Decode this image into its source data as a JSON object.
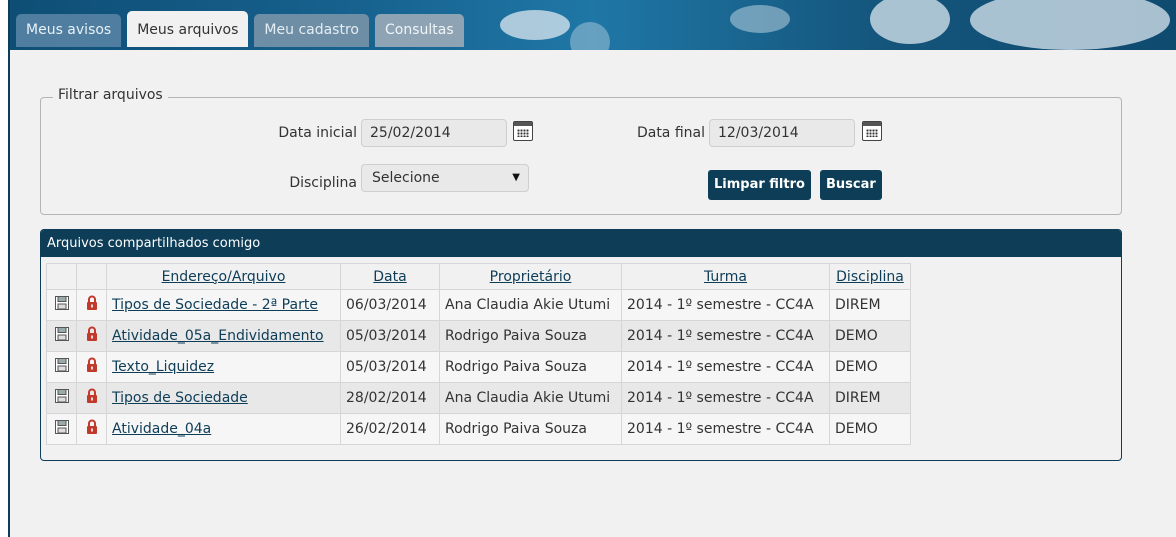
{
  "tabs": [
    {
      "label": "Meus avisos"
    },
    {
      "label": "Meus arquivos"
    },
    {
      "label": "Meu cadastro"
    },
    {
      "label": "Consultas"
    }
  ],
  "filter": {
    "legend": "Filtrar arquivos",
    "start_label": "Data inicial",
    "start_value": "25/02/2014",
    "end_label": "Data final",
    "end_value": "12/03/2014",
    "discipline_label": "Disciplina",
    "discipline_value": "Selecione",
    "clear_button": "Limpar filtro",
    "search_button": "Buscar"
  },
  "files": {
    "title": "Arquivos compartilhados comigo",
    "columns": [
      "Endereço/Arquivo",
      "Data",
      "Proprietário",
      "Turma",
      "Disciplina"
    ],
    "rows": [
      {
        "file": "Tipos de Sociedade - 2ª Parte",
        "date": "06/03/2014",
        "owner": "Ana Claudia Akie Utumi",
        "class": "2014 - 1º semestre - CC4A",
        "discipline": "DIREM"
      },
      {
        "file": "Atividade_05a_Endividamento",
        "date": "05/03/2014",
        "owner": "Rodrigo Paiva Souza",
        "class": "2014 - 1º semestre - CC4A",
        "discipline": "DEMO"
      },
      {
        "file": "Texto_Liquidez",
        "date": "05/03/2014",
        "owner": "Rodrigo Paiva Souza",
        "class": "2014 - 1º semestre - CC4A",
        "discipline": "DEMO"
      },
      {
        "file": "Tipos de Sociedade",
        "date": "28/02/2014",
        "owner": "Ana Claudia Akie Utumi",
        "class": "2014 - 1º semestre - CC4A",
        "discipline": "DIREM"
      },
      {
        "file": "Atividade_04a",
        "date": "26/02/2014",
        "owner": "Rodrigo Paiva Souza",
        "class": "2014 - 1º semestre - CC4A",
        "discipline": "DEMO"
      }
    ]
  },
  "icons": {
    "save": "floppy-disk-icon",
    "lock": "padlock-icon",
    "calendar": "calendar-icon"
  },
  "colors": {
    "header": "#0d3d57",
    "lock": "#c0392b"
  }
}
